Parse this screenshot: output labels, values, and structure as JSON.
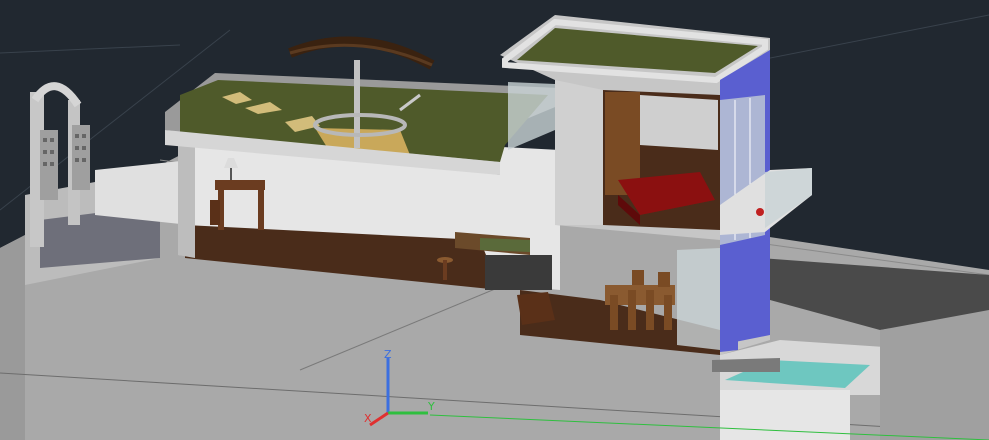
{
  "viewport": {
    "background": "#212830",
    "visual_style": "3D realistic model view"
  },
  "ucs_icon": {
    "x_label": "X",
    "y_label": "Y",
    "z_label": "Z",
    "x_color": "#e03030",
    "y_color": "#2fbf3f",
    "z_color": "#3b6fe0"
  },
  "colors": {
    "slab_gray": "#a9a9a9",
    "wall_light": "#dcdcdc",
    "accent_wall": "#5a5fd0",
    "roof_grass": "#4f5a2a",
    "wood_floor": "#4a2c1a",
    "bed_red": "#8b1010",
    "pool_water": "#6ec7c0",
    "glass": "#c9d3d6"
  }
}
